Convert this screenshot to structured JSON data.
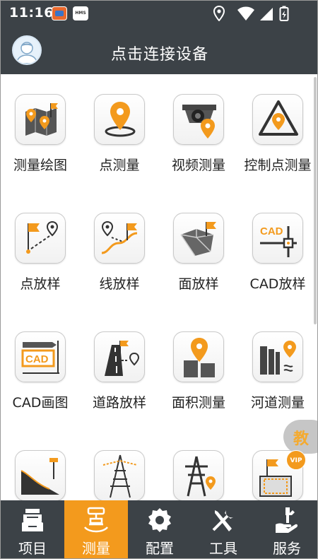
{
  "status_bar": {
    "time": "11:16",
    "notif_app_2": "HMS"
  },
  "header": {
    "title": "点击连接设备"
  },
  "grid": {
    "items": [
      {
        "label": "测量绘图",
        "icon": "survey-map-icon"
      },
      {
        "label": "点测量",
        "icon": "point-survey-icon"
      },
      {
        "label": "视频测量",
        "icon": "video-survey-icon"
      },
      {
        "label": "控制点测量",
        "icon": "control-point-icon"
      },
      {
        "label": "点放样",
        "icon": "point-stakeout-icon"
      },
      {
        "label": "线放样",
        "icon": "line-stakeout-icon"
      },
      {
        "label": "面放样",
        "icon": "area-stakeout-icon"
      },
      {
        "label": "CAD放样",
        "icon": "cad-stakeout-icon"
      },
      {
        "label": "CAD画图",
        "icon": "cad-drawing-icon"
      },
      {
        "label": "道路放样",
        "icon": "road-stakeout-icon"
      },
      {
        "label": "面积测量",
        "icon": "area-measure-icon"
      },
      {
        "label": "河道测量",
        "icon": "river-survey-icon"
      },
      {
        "label": "",
        "icon": "slope-survey-icon"
      },
      {
        "label": "",
        "icon": "tower-icon"
      },
      {
        "label": "",
        "icon": "power-tower-icon"
      },
      {
        "label": "",
        "icon": "site-survey-icon"
      }
    ]
  },
  "floating": {
    "teach_label": "教",
    "vip_label": "VIP"
  },
  "bottom_nav": {
    "items": [
      {
        "label": "项目",
        "icon": "project-icon",
        "active": false
      },
      {
        "label": "测量",
        "icon": "survey-instrument-icon",
        "active": true
      },
      {
        "label": "配置",
        "icon": "settings-gear-icon",
        "active": false
      },
      {
        "label": "工具",
        "icon": "tools-icon",
        "active": false
      },
      {
        "label": "服务",
        "icon": "service-icon",
        "active": false
      }
    ]
  },
  "colors": {
    "bar_bg": "#3c4247",
    "accent": "#f39a1d",
    "icon_dark": "#3a3a3a"
  }
}
